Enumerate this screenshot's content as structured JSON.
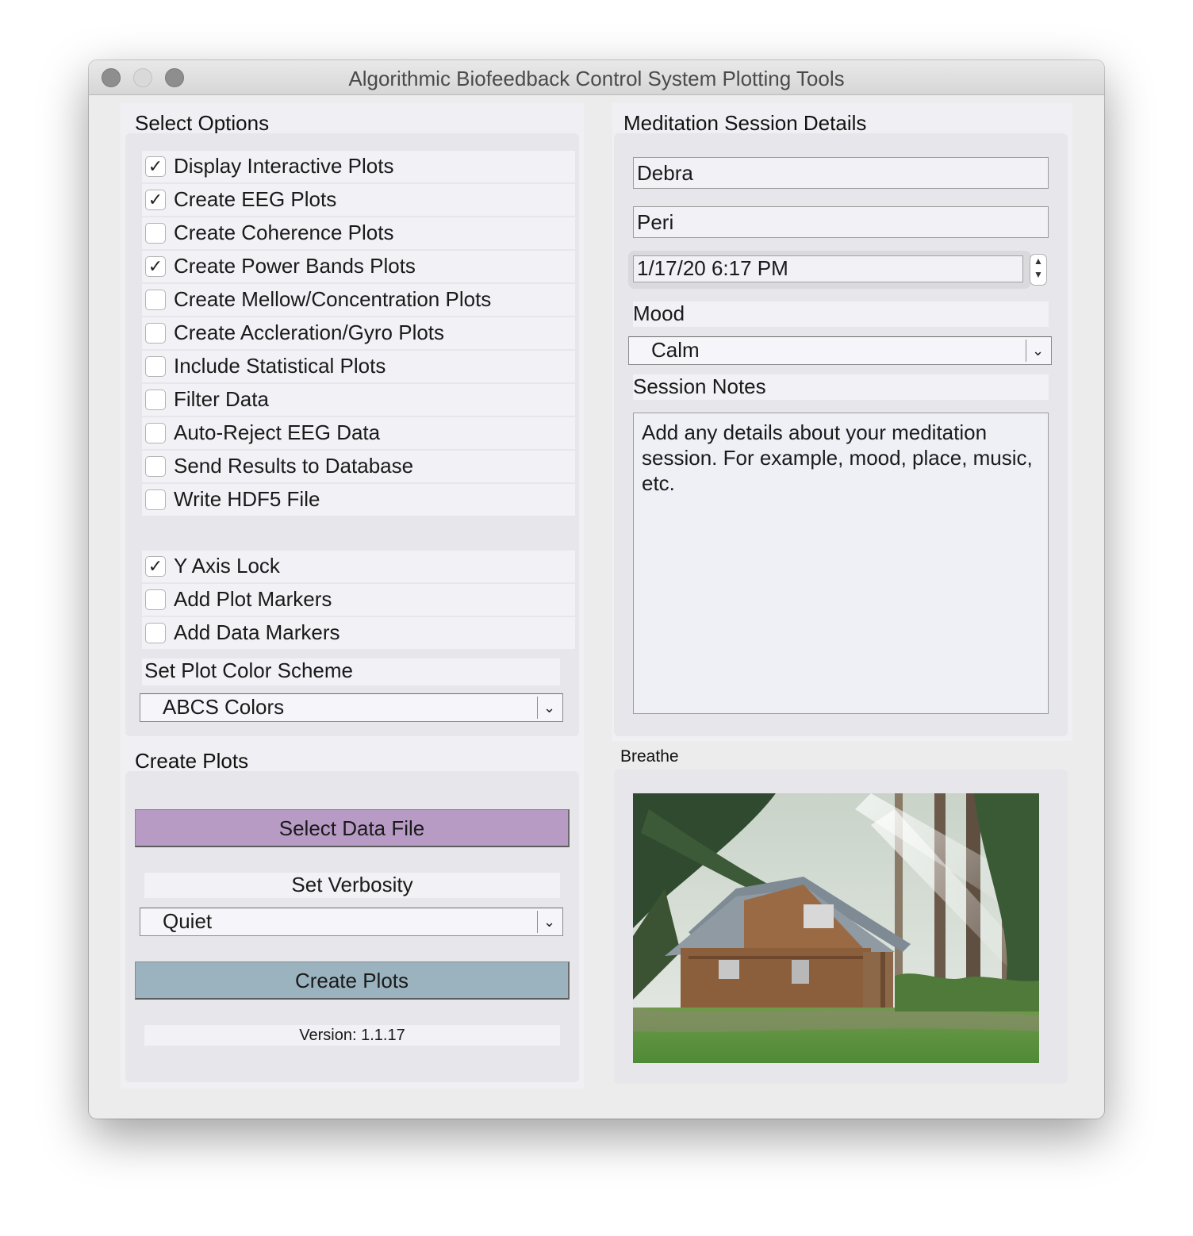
{
  "window": {
    "title": "Algorithmic Biofeedback Control System Plotting Tools"
  },
  "options": {
    "section_label": "Select Options",
    "items": [
      {
        "label": "Display Interactive Plots",
        "checked": true
      },
      {
        "label": "Create EEG Plots",
        "checked": true
      },
      {
        "label": "Create Coherence Plots",
        "checked": false
      },
      {
        "label": "Create Power Bands Plots",
        "checked": true
      },
      {
        "label": "Create Mellow/Concentration Plots",
        "checked": false
      },
      {
        "label": "Create Accleration/Gyro Plots",
        "checked": false
      },
      {
        "label": "Include Statistical Plots",
        "checked": false
      },
      {
        "label": "Filter Data",
        "checked": false
      },
      {
        "label": "Auto-Reject EEG Data",
        "checked": false
      },
      {
        "label": "Send Results to Database",
        "checked": false
      },
      {
        "label": "Write HDF5 File",
        "checked": false
      },
      {
        "label": "Y Axis Lock",
        "checked": true
      },
      {
        "label": "Add Plot Markers",
        "checked": false
      },
      {
        "label": "Add Data Markers",
        "checked": false
      }
    ],
    "color_scheme_label": "Set Plot Color Scheme",
    "color_scheme_value": "ABCS Colors"
  },
  "create": {
    "section_label": "Create Plots",
    "select_file_label": "Select Data File",
    "verbosity_label": "Set Verbosity",
    "verbosity_value": "Quiet",
    "create_button_label": "Create Plots",
    "version": "Version: 1.1.17"
  },
  "session": {
    "section_label": "Meditation Session Details",
    "first_name": "Debra",
    "last_name": "Peri",
    "datetime": "1/17/20 6:17 PM",
    "mood_label": "Mood",
    "mood_value": "Calm",
    "notes_label": "Session Notes",
    "notes_text": "Add any details about your meditation session.  For example, mood, place, music, etc."
  },
  "breathe": {
    "label": "Breathe"
  },
  "colors": {
    "select_file_button": "#b89bc5",
    "create_button": "#9bb3bf"
  },
  "icons": {
    "check": "✓",
    "chevron": "chevron-down-icon",
    "stepper": "stepper-icon"
  }
}
